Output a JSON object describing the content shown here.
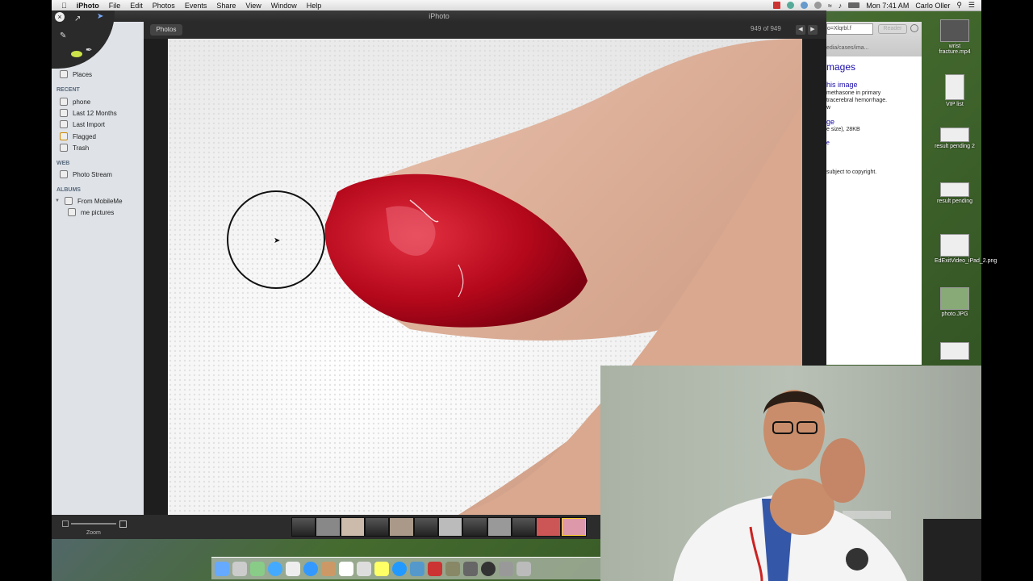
{
  "menubar": {
    "items": [
      "iPhoto",
      "File",
      "Edit",
      "Photos",
      "Events",
      "Share",
      "View",
      "Window",
      "Help"
    ],
    "clock": "Mon 7:41 AM",
    "user": "Carlo Oller"
  },
  "window": {
    "title": "iPhoto"
  },
  "sidebar": {
    "top_item": "Places",
    "recent_header": "RECENT",
    "recent": [
      "phone",
      "Last 12 Months",
      "Last Import",
      "Flagged",
      "Trash"
    ],
    "web_header": "WEB",
    "web": [
      "Photo Stream"
    ],
    "albums_header": "ALBUMS",
    "albums": [
      "From MobileMe",
      "me pictures"
    ]
  },
  "viewer": {
    "photos_button": "Photos",
    "count": "949 of 949"
  },
  "bottom": {
    "zoom_label": "Zoom"
  },
  "browser": {
    "url": "o=Xlqrbl.f",
    "reader": "Reader",
    "path": "edia/cases/ima...",
    "heading": "mages",
    "link1": "his image",
    "text1": "methasone in primary",
    "text2": "tracerebral hemorrhage.",
    "text3": "w",
    "link2": "ge",
    "text4": "e size), 28KB",
    "link3": "e",
    "text5": "subject to copyright."
  },
  "desktop_icons": [
    {
      "label": "wrist fracture.mp4"
    },
    {
      "label": "VIP list"
    },
    {
      "label": "result pending 2"
    },
    {
      "label": "result pending"
    },
    {
      "label": "EdExitVideo_iPad_2.png"
    },
    {
      "label": "photo.JPG"
    }
  ]
}
